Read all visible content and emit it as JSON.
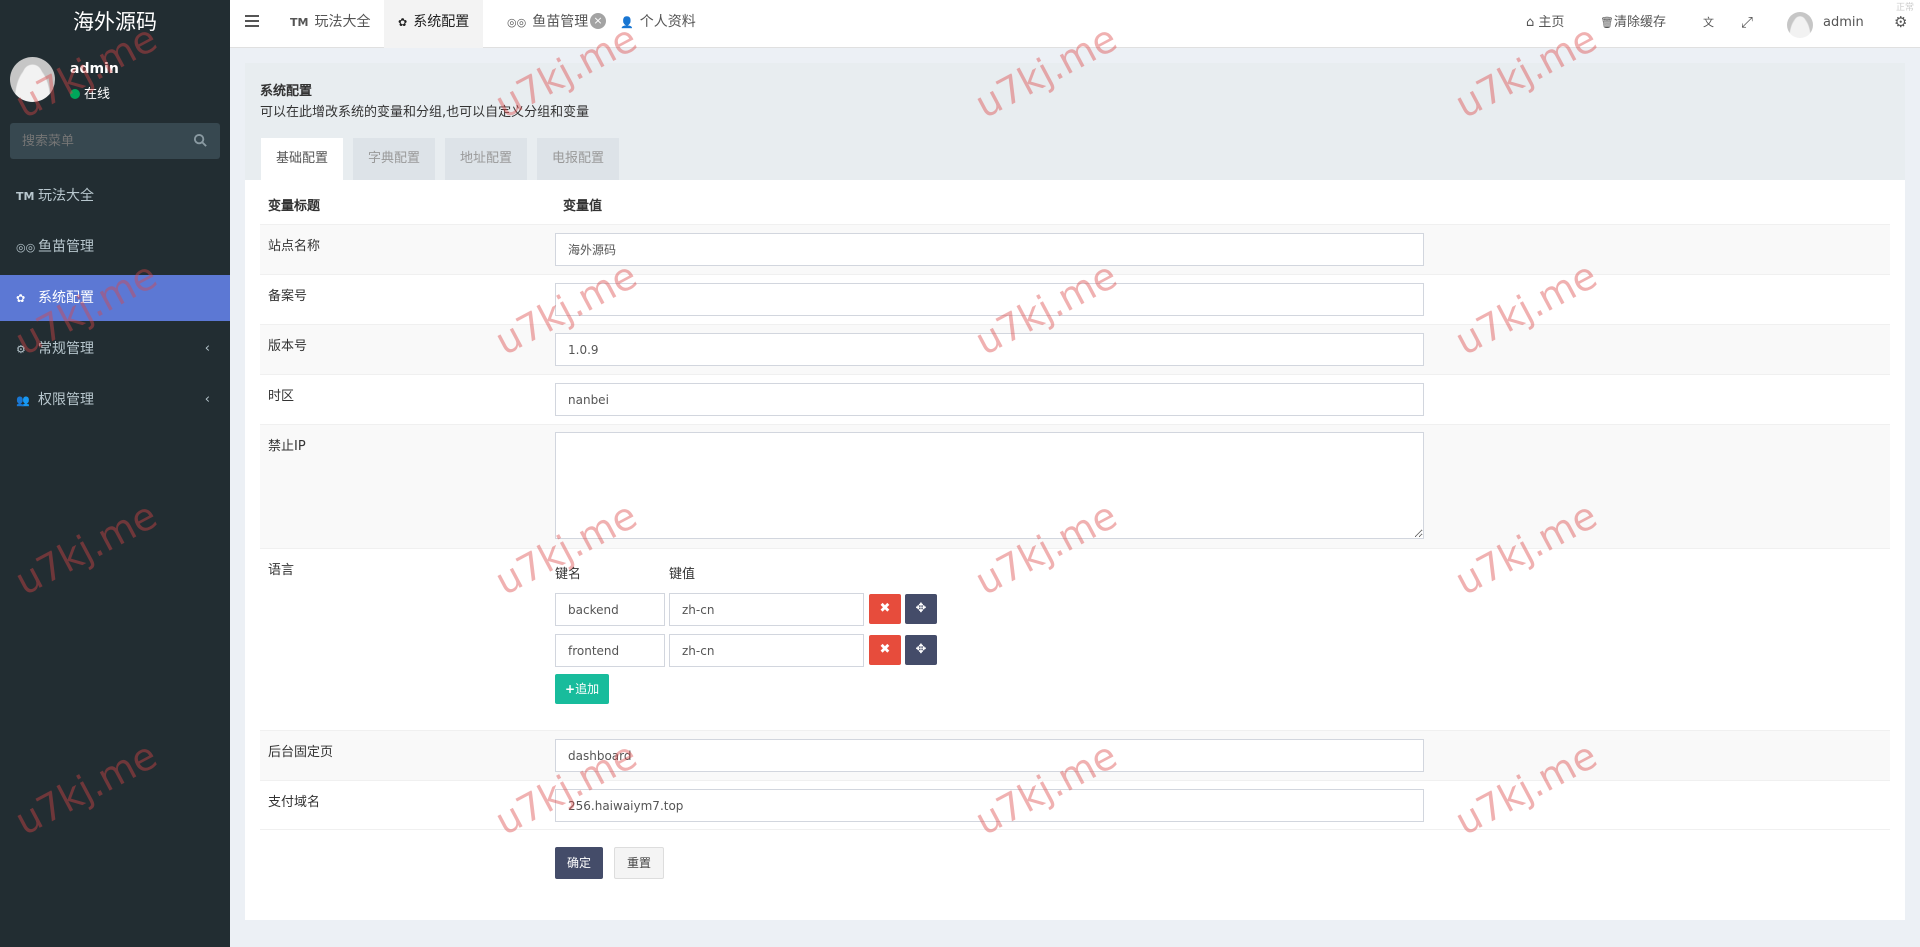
{
  "sidebar": {
    "logo": "海外源码",
    "user": {
      "name": "admin",
      "status": "在线"
    },
    "search_placeholder": "搜索菜单",
    "items": [
      {
        "icon": "trademark-icon",
        "icon_glyph": "TM",
        "label": "玩法大全",
        "active": false,
        "has_children": false
      },
      {
        "icon": "tripadvisor-icon",
        "icon_glyph": "◎◎",
        "label": "鱼苗管理",
        "active": false,
        "has_children": false
      },
      {
        "icon": "gear-icon",
        "icon_glyph": "✿",
        "label": "系统配置",
        "active": true,
        "has_children": false
      },
      {
        "icon": "cogs-icon",
        "icon_glyph": "⚙",
        "label": "常规管理",
        "active": false,
        "has_children": true
      },
      {
        "icon": "users-icon",
        "icon_glyph": "👥",
        "label": "权限管理",
        "active": false,
        "has_children": true
      }
    ],
    "chevron": "‹"
  },
  "topbar": {
    "tabs": [
      {
        "icon_glyph": "TM",
        "label": "玩法大全",
        "active": false
      },
      {
        "icon_glyph": "✿",
        "label": "系统配置",
        "active": true
      },
      {
        "icon_glyph": "◎◎",
        "label": "鱼苗管理",
        "active": false,
        "closable": true
      },
      {
        "icon_glyph": "👤",
        "label": "个人资料",
        "active": false
      }
    ],
    "close_glyph": "×",
    "home_label": "主页",
    "home_glyph": "⌂",
    "clear_cache_label": "清除缓存",
    "clear_cache_glyph": "🗑",
    "translate_glyph": "文",
    "fullscreen_glyph": "⤢",
    "user_name": "admin",
    "settings_glyph": "⚙",
    "corner_text": "正常"
  },
  "panel": {
    "title": "系统配置",
    "description": "可以在此增改系统的变量和分组,也可以自定义分组和变量",
    "tabs": [
      "基础配置",
      "字典配置",
      "地址配置",
      "电报配置"
    ],
    "header_title_col": "变量标题",
    "header_value_col": "变量值",
    "rows": {
      "site_name": {
        "label": "站点名称",
        "value": "海外源码"
      },
      "beian": {
        "label": "备案号",
        "value": ""
      },
      "version": {
        "label": "版本号",
        "value": "1.0.9"
      },
      "timezone": {
        "label": "时区",
        "value": "nanbei"
      },
      "forbidden_ip": {
        "label": "禁止IP",
        "value": ""
      },
      "language": {
        "label": "语言",
        "key_header": "键名",
        "value_header": "键值",
        "pairs": [
          {
            "key": "backend",
            "value": "zh-cn"
          },
          {
            "key": "frontend",
            "value": "zh-cn"
          }
        ],
        "remove_glyph": "✖",
        "drag_glyph": "✥",
        "add_label": "追加",
        "add_glyph": "+"
      },
      "fixed_page": {
        "label": "后台固定页",
        "value": "dashboard"
      },
      "pay_domain": {
        "label": "支付域名",
        "value": "256.haiwaiym7.top"
      }
    },
    "submit_label": "确定",
    "reset_label": "重置"
  },
  "watermark": {
    "text": "u7kj.me"
  }
}
